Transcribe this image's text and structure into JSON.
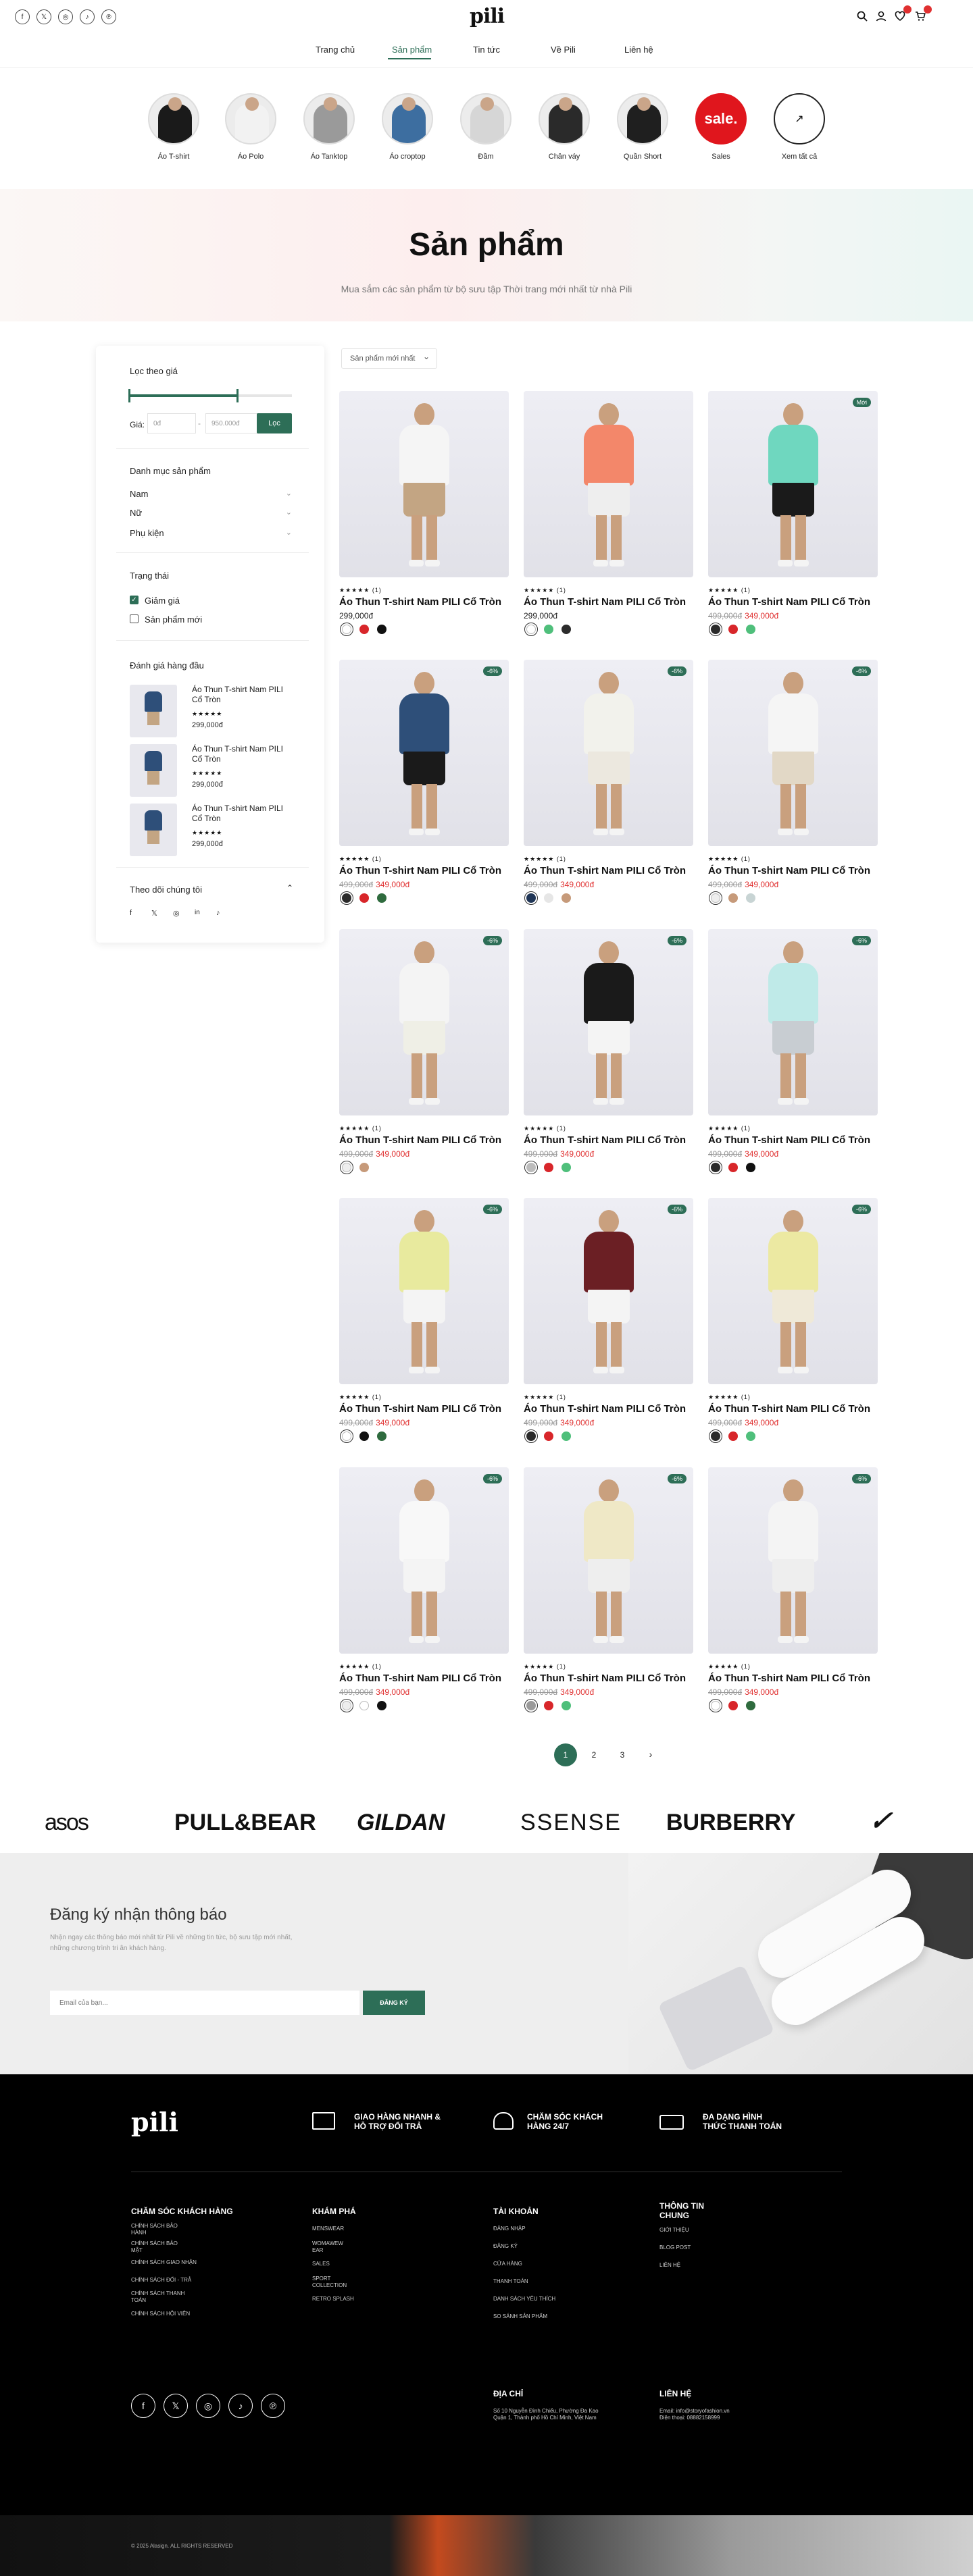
{
  "header": {
    "logo": "pili",
    "social": [
      "f",
      "𝕏",
      "◎",
      "♪",
      "℗"
    ],
    "cart_count": "",
    "nav": [
      "Trang chủ",
      "Sản phẩm",
      "Tin tức",
      "Về Pili",
      "Liên hệ"
    ]
  },
  "categories": [
    {
      "label": "Áo T-shirt",
      "color": "#1a1a1a"
    },
    {
      "label": "Áo Polo",
      "color": "#f2f2f2"
    },
    {
      "label": "Áo Tanktop",
      "color": "#9a9a9a"
    },
    {
      "label": "Áo croptop",
      "color": "#3d6ea0"
    },
    {
      "label": "Đầm",
      "color": "#d6d6d6"
    },
    {
      "label": "Chân váy",
      "color": "#2a2a2a"
    },
    {
      "label": "Quần Short",
      "color": "#1f1f1f"
    },
    {
      "label": "Sales",
      "sale_text": "sale."
    },
    {
      "label": "Xem tất cả",
      "arrow": "↗"
    }
  ],
  "hero": {
    "title": "Sản phẩm",
    "subtitle": "Mua sắm các sản phẩm từ bộ sưu tập Thời trang mới nhất từ nhà Pili"
  },
  "sidebar": {
    "price_filter_title": "Lọc theo giá",
    "price_label": "Giá:",
    "price_min": "0đ",
    "price_max": "950.000đ",
    "filter_button": "Lọc",
    "category_title": "Danh mục sản phẩm",
    "categories": [
      "Nam",
      "Nữ",
      "Phụ kiện"
    ],
    "status_title": "Trạng thái",
    "status": [
      {
        "label": "Giảm giá",
        "checked": true
      },
      {
        "label": "Sản phẩm mới",
        "checked": false
      }
    ],
    "top_rated_title": "Đánh giá hàng đầu",
    "top_rated": [
      {
        "name": "Áo Thun T-shirt Nam PILI Cổ Tròn",
        "stars": "★★★★★",
        "price": "299,000đ"
      },
      {
        "name": "Áo Thun T-shirt Nam PILI Cổ Tròn",
        "stars": "★★★★★",
        "price": "299,000đ"
      },
      {
        "name": "Áo Thun T-shirt Nam PILI Cổ Tròn",
        "stars": "★★★★★",
        "price": "299,000đ"
      }
    ],
    "follow_title": "Theo dõi chúng tôi",
    "follow_icons": [
      "f",
      "𝕏",
      "◎",
      "in",
      "♪"
    ]
  },
  "sort": {
    "label": "Sản phẩm mới nhất",
    "chevron": "⌄"
  },
  "product_name": "Áo Thun T-shirt Nam PILI Cổ Tròn",
  "products": [
    {
      "stars": "★★★★★ (1)",
      "old": "",
      "price": "299,000đ",
      "tag": "",
      "top": "#f5f5f5",
      "bottom": "#c3a583",
      "swatches": [
        "#ffffff",
        "#d8262a",
        "#111111"
      ]
    },
    {
      "stars": "★★★★★ (1)",
      "old": "",
      "price": "299,000đ",
      "tag": "",
      "top": "#f3876a",
      "bottom": "#eeeeee",
      "swatches": [
        "#ffffff",
        "#4fbf7b",
        "#2c2c2c"
      ]
    },
    {
      "stars": "★★★★★ (1)",
      "old": "499,000đ",
      "price": "349,000đ",
      "tag": "Mới",
      "top": "#6fd7bf",
      "bottom": "#1a1a1a",
      "swatches": [
        "#2a2a2a",
        "#d8262a",
        "#4fbf7b"
      ]
    },
    {
      "stars": "★★★★★ (1)",
      "old": "499,000đ",
      "price": "349,000đ",
      "tag": "-6%",
      "top": "#2e4f79",
      "bottom": "#1a1a1a",
      "swatches": [
        "#2a2a2a",
        "#d8262a",
        "#2f6b3e"
      ]
    },
    {
      "stars": "★★★★★ (1)",
      "old": "499,000đ",
      "price": "349,000đ",
      "tag": "-6%",
      "top": "#f2f2ec",
      "bottom": "#ece8df",
      "swatches": [
        "#1f3556",
        "#e6e6e6",
        "#c69a7a"
      ]
    },
    {
      "stars": "★★★★★ (1)",
      "old": "499,000đ",
      "price": "349,000đ",
      "tag": "-6%",
      "top": "#f5f5f5",
      "bottom": "#e2d8c6",
      "swatches": [
        "#eeeeee",
        "#c69a7a",
        "#c8d4d4"
      ]
    },
    {
      "stars": "★★★★★ (1)",
      "old": "499,000đ",
      "price": "349,000đ",
      "tag": "-6%",
      "top": "#f4f4f4",
      "bottom": "#efefe6",
      "swatches": [
        "#eeeeee",
        "#c69a7a"
      ]
    },
    {
      "stars": "★★★★★ (1)",
      "old": "499,000đ",
      "price": "349,000đ",
      "tag": "-6%",
      "top": "#1a1a1a",
      "bottom": "#f4f4f4",
      "swatches": [
        "#bcbcbc",
        "#d8262a",
        "#4fbf7b"
      ]
    },
    {
      "stars": "★★★★★ (1)",
      "old": "499,000đ",
      "price": "349,000đ",
      "tag": "-6%",
      "top": "#bfeae8",
      "bottom": "#c8cdd2",
      "swatches": [
        "#2a2a2a",
        "#d8262a",
        "#111111"
      ]
    },
    {
      "stars": "★★★★★ (1)",
      "old": "499,000đ",
      "price": "349,000đ",
      "tag": "-6%",
      "top": "#e8ea9e",
      "bottom": "#f4f4f4",
      "swatches": [
        "#ffffff",
        "#111111",
        "#2f6b3e"
      ]
    },
    {
      "stars": "★★★★★ (1)",
      "old": "499,000đ",
      "price": "349,000đ",
      "tag": "-6%",
      "top": "#6b1f24",
      "bottom": "#f4f4f4",
      "swatches": [
        "#2a2a2a",
        "#d8262a",
        "#4fbf7b"
      ]
    },
    {
      "stars": "★★★★★ (1)",
      "old": "499,000đ",
      "price": "349,000đ",
      "tag": "-6%",
      "top": "#ece9a2",
      "bottom": "#efe9d8",
      "swatches": [
        "#2a2a2a",
        "#d8262a",
        "#4fbf7b"
      ]
    },
    {
      "stars": "★★★★★ (1)",
      "old": "499,000đ",
      "price": "349,000đ",
      "tag": "-6%",
      "top": "#f8f8f8",
      "bottom": "#f4f4f4",
      "swatches": [
        "#eeeeee",
        "#ffffff",
        "#111111"
      ]
    },
    {
      "stars": "★★★★★ (1)",
      "old": "499,000đ",
      "price": "349,000đ",
      "tag": "-6%",
      "top": "#efe8c6",
      "bottom": "#eeeeee",
      "swatches": [
        "#9a9a9a",
        "#d8262a",
        "#4fbf7b"
      ]
    },
    {
      "stars": "★★★★★ (1)",
      "old": "499,000đ",
      "price": "349,000đ",
      "tag": "-6%",
      "top": "#f4f4f4",
      "bottom": "#eeeeee",
      "swatches": [
        "#ffffff",
        "#d8262a",
        "#2f6b3e"
      ]
    }
  ],
  "pagination": [
    "1",
    "2",
    "3",
    "›"
  ],
  "brands": [
    "asos",
    "PULL&BEAR",
    "GILDAN",
    "SSENSE",
    "BURBERRY",
    "✓"
  ],
  "newsletter": {
    "title": "Đăng ký nhận thông báo",
    "desc1": "Nhận ngay các thông báo mới nhất từ Pili về những tin tức, bộ sưu tập mới nhất,",
    "desc2": "những chương trình tri ân khách hàng.",
    "placeholder": "Email của bạn...",
    "button": "ĐĂNG KÝ"
  },
  "footer": {
    "logo": "pili",
    "features": [
      "GIAO HÀNG NHANH &",
      "HỖ TRỢ ĐỔI TRẢ",
      "CHĂM SÓC KHÁCH",
      "HÀNG 24/7",
      "ĐA DẠNG HÌNH",
      "THỨC THANH TOÁN"
    ],
    "col1_title": "CHĂM SÓC KHÁCH HÀNG",
    "col1": [
      "CHÍNH SÁCH BẢO",
      "HÀNH",
      "CHÍNH SÁCH BẢO",
      "MẬT",
      "CHÍNH SÁCH GIAO NHẬN",
      "CHÍNH SÁCH ĐỔI - TRẢ",
      "CHÍNH SÁCH THANH",
      "TOÁN",
      "CHÍNH SÁCH HỘI VIÊN"
    ],
    "col2_title": "KHÁM PHÁ",
    "col2": [
      "MENSWEAR",
      "WOMAWEW",
      "EAR",
      "SALES",
      "SPORT",
      "COLLECTION",
      "RETRO SPLASH"
    ],
    "col3_title": "TÀI KHOẢN",
    "col3": [
      "ĐĂNG NHẬP",
      "ĐĂNG KÝ",
      "CỬA HÀNG",
      "THANH TOÁN",
      "DANH SÁCH YÊU THÍCH",
      "SO SÁNH SẢN PHẨM"
    ],
    "col4_title1": "THÔNG TIN",
    "col4_title2": "CHUNG",
    "col4": [
      "GIỚI THIỆU",
      "BLOG POST",
      "LIÊN HỆ"
    ],
    "address_title": "ĐỊA CHỈ",
    "address1": "Số 10 Nguyễn Đình Chiểu, Phường Đa Kao",
    "address2": "Quận 1, Thành phố Hồ Chí Minh, Việt Nam",
    "contact_title": "LIÊN HỆ",
    "email": "Email: info@storyofashion.vn",
    "phone": "Điện thoại: 08882158999",
    "socials": [
      "f",
      "𝕏",
      "◎",
      "♪",
      "℗"
    ],
    "copyright": "© 2025 Alasign. ALL RIGHTS RESERVED"
  }
}
